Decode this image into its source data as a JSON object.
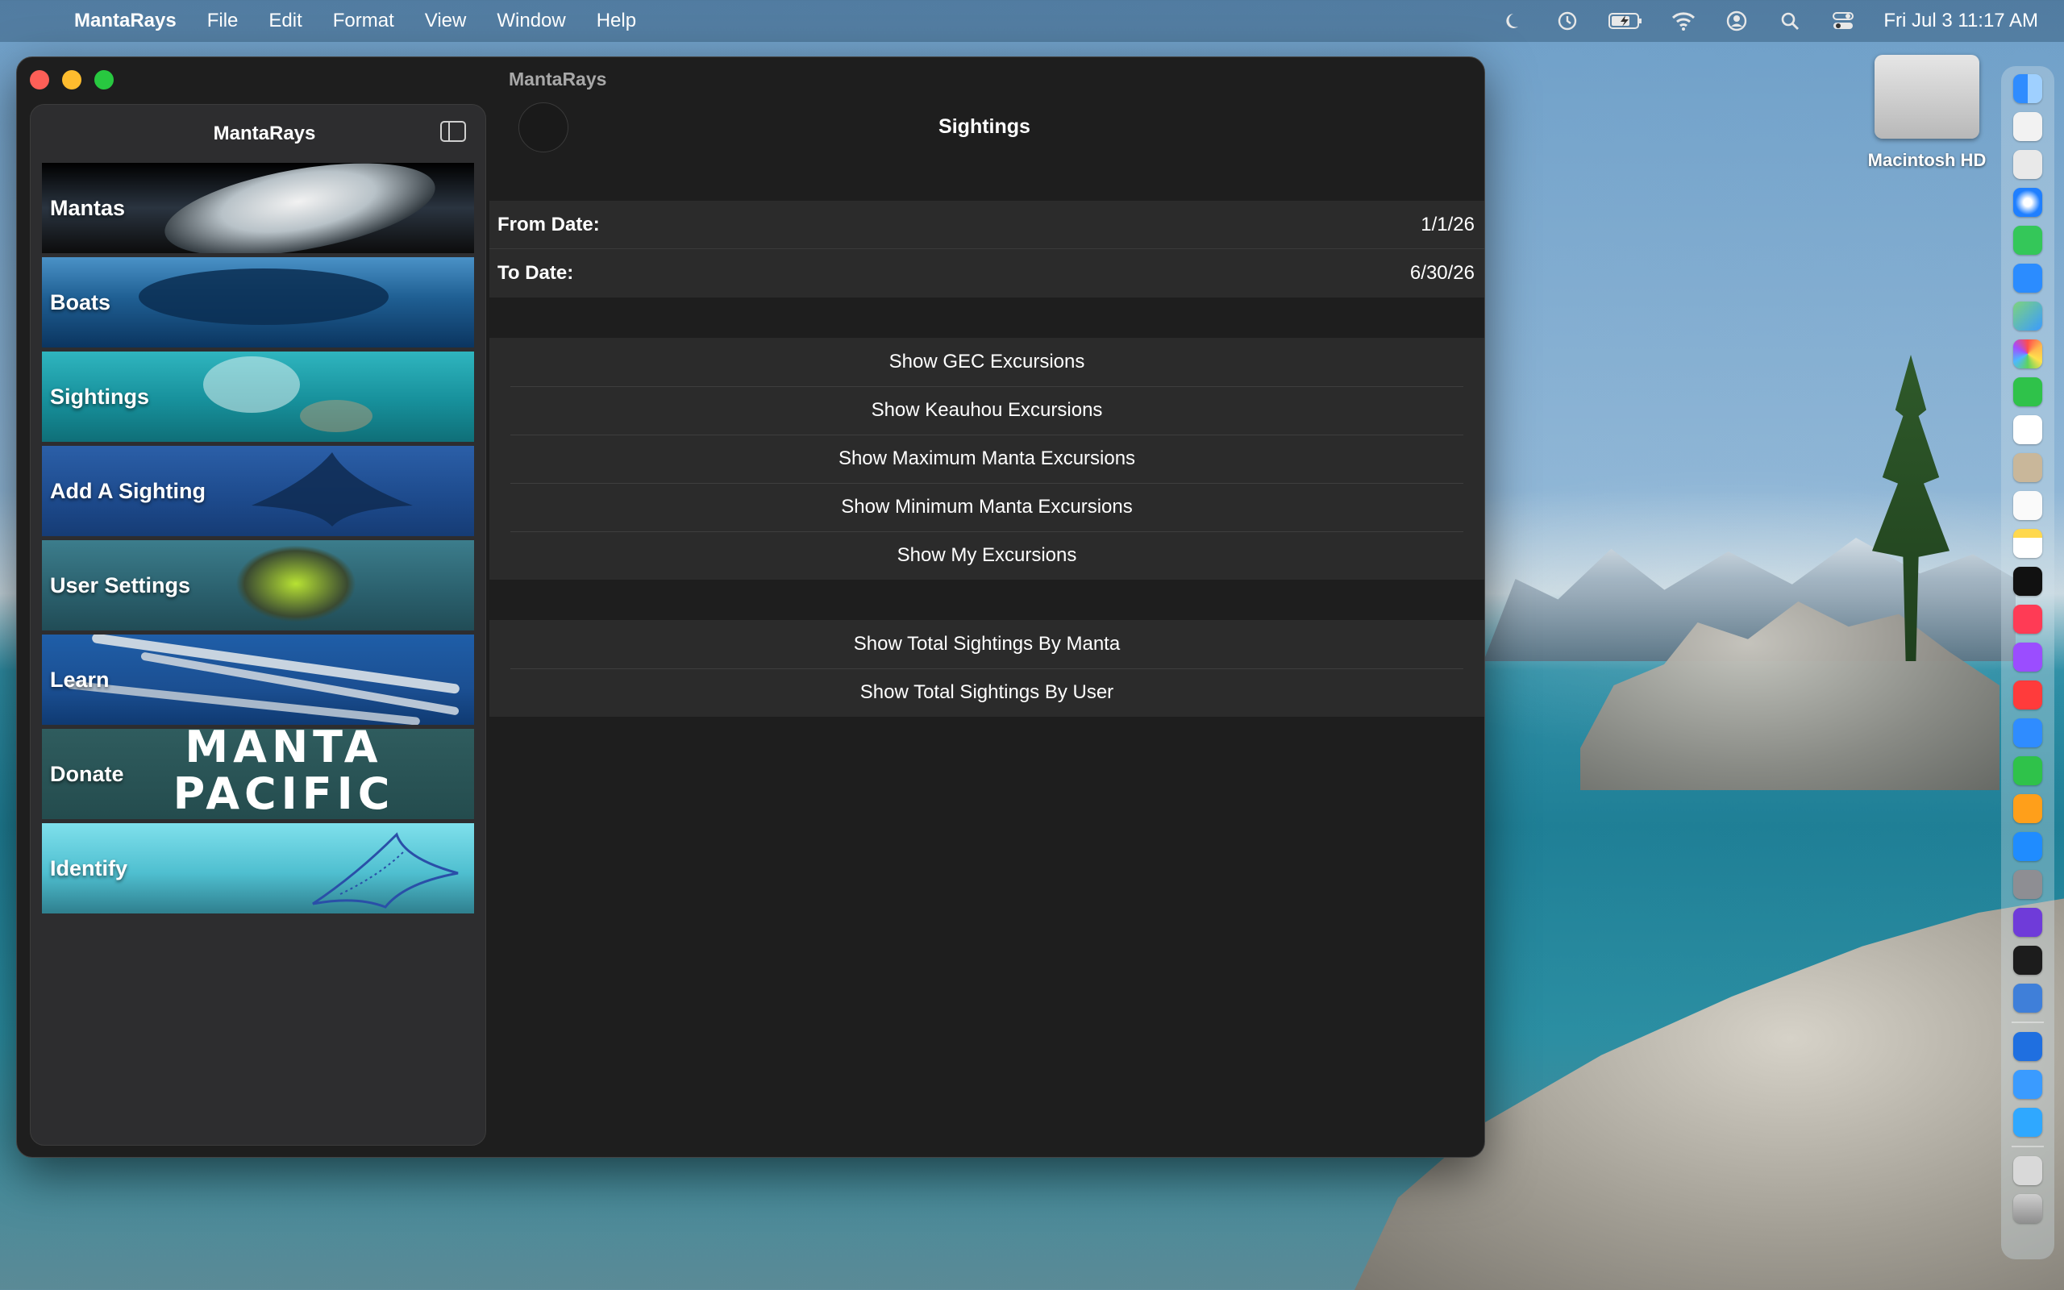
{
  "menubar": {
    "app_name": "MantaRays",
    "menus": [
      "File",
      "Edit",
      "Format",
      "View",
      "Window",
      "Help"
    ],
    "clock": "Fri Jul 3  11:17 AM"
  },
  "desktop": {
    "drive_label": "Macintosh HD"
  },
  "window": {
    "title": "MantaRays",
    "sidebar_title": "MantaRays",
    "page_title": "Sightings"
  },
  "sidebar": {
    "items": [
      {
        "label": "Mantas"
      },
      {
        "label": "Boats"
      },
      {
        "label": "Sightings"
      },
      {
        "label": "Add A Sighting"
      },
      {
        "label": "User Settings"
      },
      {
        "label": "Learn"
      },
      {
        "label": "Donate",
        "banner_line1": "MANTA",
        "banner_line2": "PACIFIC"
      },
      {
        "label": "Identify"
      }
    ]
  },
  "date_range": {
    "from_label": "From Date:",
    "from_value": "1/1/26",
    "to_label": "To Date:",
    "to_value": "6/30/26"
  },
  "excursion_buttons": [
    "Show GEC Excursions",
    "Show Keauhou Excursions",
    "Show Maximum Manta Excursions",
    "Show Minimum Manta Excursions",
    "Show My Excursions"
  ],
  "total_buttons": [
    "Show Total Sightings By Manta",
    "Show Total Sightings By User"
  ],
  "colors": {
    "selection": "#4a8cff",
    "window_bg": "#1e1e1e",
    "row_bg": "#2b2b2b"
  }
}
